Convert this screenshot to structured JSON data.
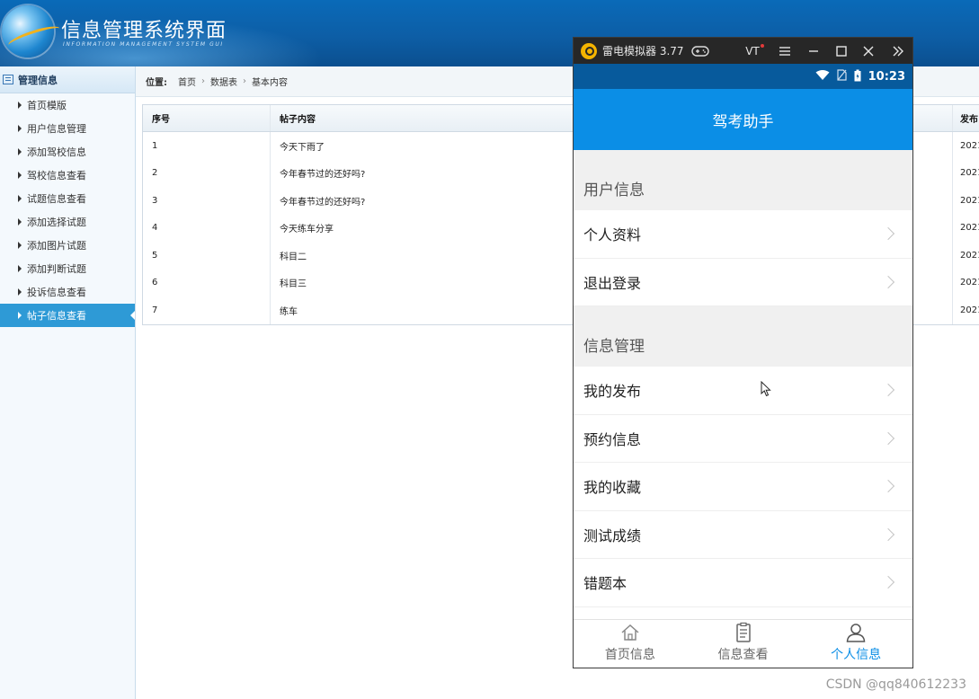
{
  "header": {
    "title": "信息管理系统界面",
    "subtitle": "INFORMATION MANAGEMENT SYSTEM GUI"
  },
  "sidebar": {
    "heading": "管理信息",
    "items": [
      {
        "label": "首页模版"
      },
      {
        "label": "用户信息管理"
      },
      {
        "label": "添加驾校信息"
      },
      {
        "label": "驾校信息查看"
      },
      {
        "label": "试题信息查看"
      },
      {
        "label": "添加选择试题"
      },
      {
        "label": "添加图片试题"
      },
      {
        "label": "添加判断试题"
      },
      {
        "label": "投诉信息查看"
      },
      {
        "label": "帖子信息查看",
        "active": true
      }
    ]
  },
  "breadcrumb": {
    "prefix": "位置:",
    "items": [
      "首页",
      "数据表",
      "基本内容"
    ],
    "separator": "›"
  },
  "table": {
    "columns": [
      "序号",
      "帖子内容",
      "发布"
    ],
    "rows": [
      {
        "no": "1",
        "content": "今天下雨了",
        "date": "2021"
      },
      {
        "no": "2",
        "content": "今年春节过的还好吗?",
        "date": "2021"
      },
      {
        "no": "3",
        "content": "今年春节过的还好吗?",
        "date": "2021"
      },
      {
        "no": "4",
        "content": "今天练车分享",
        "date": "2021"
      },
      {
        "no": "5",
        "content": "科目二",
        "date": "2021"
      },
      {
        "no": "6",
        "content": "科目三",
        "date": "2021"
      },
      {
        "no": "7",
        "content": "练车",
        "date": "2021"
      }
    ]
  },
  "emulator": {
    "title": "雷电模拟器 3.77",
    "vt": "VT",
    "status_time": "10:23",
    "app_title": "驾考助手",
    "sections": [
      {
        "heading": "用户信息",
        "items": [
          "个人资料",
          "退出登录"
        ]
      },
      {
        "heading": "信息管理",
        "items": [
          "我的发布",
          "预约信息",
          "我的收藏",
          "测试成绩",
          "错题本"
        ]
      }
    ],
    "tabs": [
      {
        "label": "首页信息",
        "icon": "home-icon"
      },
      {
        "label": "信息查看",
        "icon": "document-icon"
      },
      {
        "label": "个人信息",
        "icon": "person-icon",
        "active": true
      }
    ],
    "accent_color": "#0b8ee6"
  },
  "watermark": "CSDN @qq840612233"
}
